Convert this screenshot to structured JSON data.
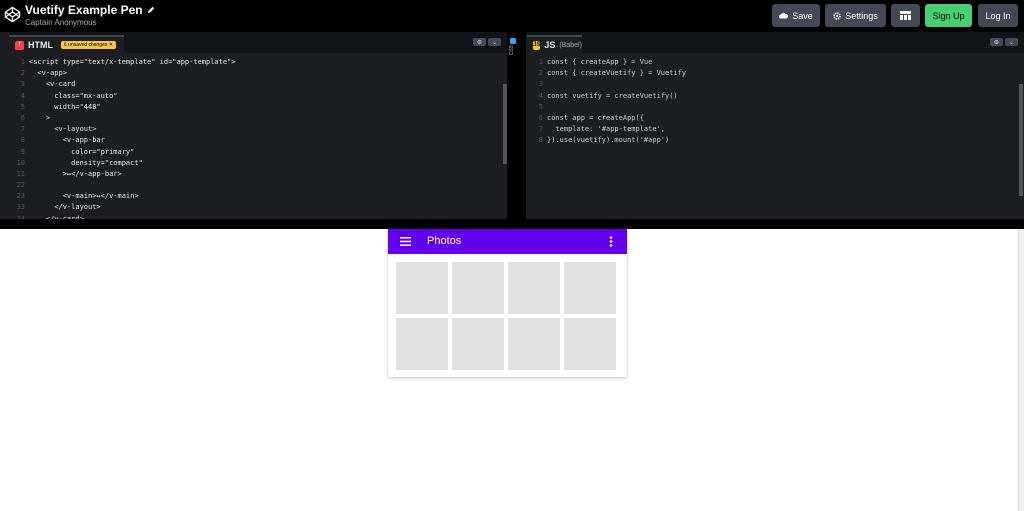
{
  "header": {
    "title": "Vuetify Example Pen",
    "author": "Captain Anonymous",
    "buttons": {
      "save": "Save",
      "settings": "Settings",
      "signup": "Sign Up",
      "login": "Log In"
    }
  },
  "html_pane": {
    "label": "HTML",
    "unsaved": "6 unsaved changes ✕",
    "lines": [
      {
        "n": "1",
        "t": "<script type=\"text/x-template\" id=\"app-template\">"
      },
      {
        "n": "2",
        "t": "  <v-app>"
      },
      {
        "n": "3",
        "t": "    <v-card"
      },
      {
        "n": "4",
        "t": "      class=\"mx-auto\""
      },
      {
        "n": "5",
        "t": "      width=\"448\""
      },
      {
        "n": "6",
        "t": "    >"
      },
      {
        "n": "7",
        "t": "      <v-layout>"
      },
      {
        "n": "8",
        "t": "        <v-app-bar"
      },
      {
        "n": "9",
        "t": "          color=\"primary\""
      },
      {
        "n": "10",
        "t": "          density=\"compact\""
      },
      {
        "n": "11",
        "t": "        >↔</v-app-bar>"
      },
      {
        "n": "22",
        "t": ""
      },
      {
        "n": "23",
        "t": "        <v-main>↔</v-main>"
      },
      {
        "n": "33",
        "t": "      </v-layout>"
      },
      {
        "n": "34",
        "t": "    </v-card>"
      }
    ]
  },
  "css_pane": {
    "label": "CSS"
  },
  "js_pane": {
    "label": "JS",
    "sublabel": "(Babel)",
    "lines": [
      {
        "n": "1",
        "t": "const { createApp } = Vue"
      },
      {
        "n": "2",
        "t": "const { createVuetify } = Vuetify"
      },
      {
        "n": "3",
        "t": ""
      },
      {
        "n": "4",
        "t": "const vuetify = createVuetify()"
      },
      {
        "n": "5",
        "t": ""
      },
      {
        "n": "6",
        "t": "const app = createApp({"
      },
      {
        "n": "7",
        "t": "  template: '#app-template',"
      },
      {
        "n": "8",
        "t": "}).use(vuetify).mount('#app')"
      }
    ]
  },
  "preview": {
    "appbar_title": "Photos",
    "photo_count": 8
  },
  "colors": {
    "header_bg": "#000000",
    "editor_bg": "#1d1e22",
    "signup_green": "#47cf73",
    "appbar_primary": "#6200ee",
    "photo_placeholder": "#e0e0e0"
  }
}
